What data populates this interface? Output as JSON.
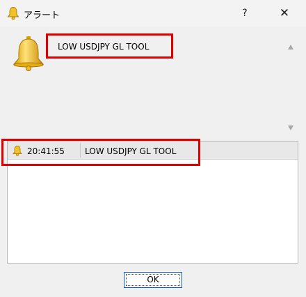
{
  "window": {
    "title": "アラート",
    "help_label": "?",
    "close_label": "✕"
  },
  "message": {
    "text": "LOW USDJPY GL TOOL"
  },
  "alert_list": {
    "rows": [
      {
        "time": "20:41:55",
        "message": "LOW USDJPY GL TOOL"
      }
    ]
  },
  "buttons": {
    "ok_label": "OK"
  },
  "colors": {
    "highlight": "#e10000",
    "bell": "#f2c12e",
    "ok_border": "#0a59c8"
  },
  "icons": [
    "bell-icon",
    "help-icon",
    "close-icon",
    "scroll-up-icon",
    "scroll-down-icon"
  ]
}
